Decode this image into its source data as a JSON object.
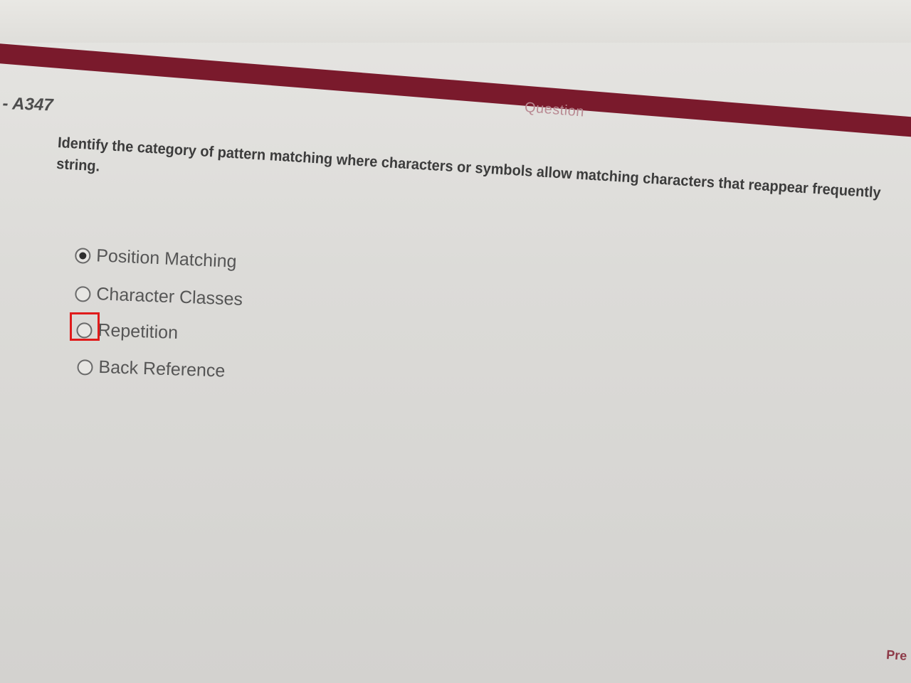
{
  "header": {
    "code": "- A347",
    "label": "Question"
  },
  "question": {
    "line1": "Identify the category of pattern matching where characters or symbols allow matching characters that reappear frequently",
    "line2": "string."
  },
  "options": [
    {
      "label": "Position Matching",
      "selected": true
    },
    {
      "label": "Character Classes",
      "selected": false
    },
    {
      "label": "Repetition",
      "selected": false
    },
    {
      "label": "Back Reference",
      "selected": false
    }
  ],
  "footer": {
    "prev_label": "Pre"
  },
  "colors": {
    "header_bar": "#7a1a2c",
    "highlight": "#e01b1b"
  }
}
